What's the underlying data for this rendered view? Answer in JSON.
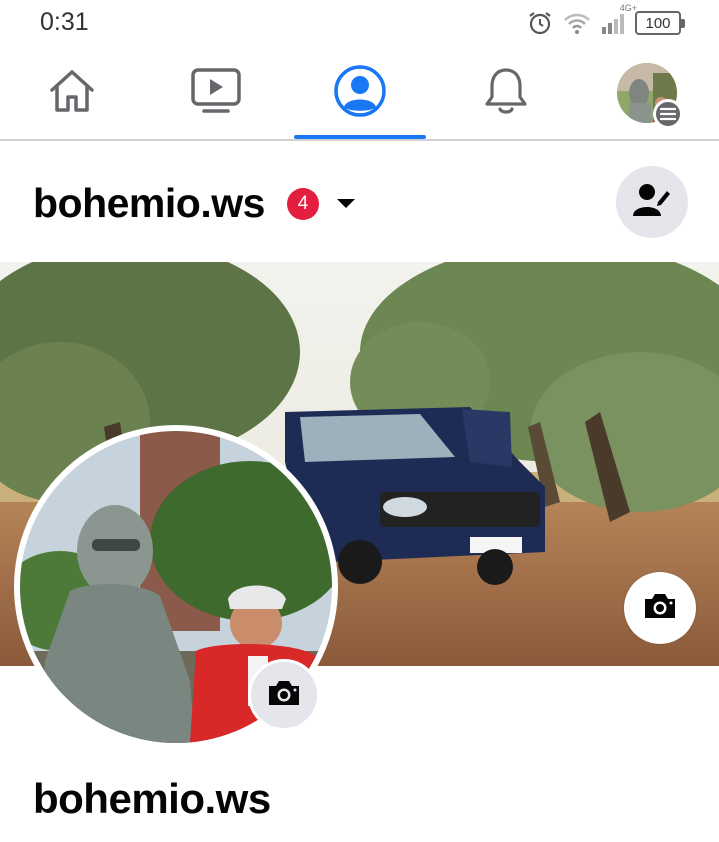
{
  "status_bar": {
    "time": "0:31",
    "network_label": "4G+",
    "battery": "100",
    "icons": [
      "alarm-icon",
      "wifi-icon",
      "signal-icon",
      "battery-icon"
    ]
  },
  "nav": {
    "items": [
      {
        "name": "home",
        "icon": "home-icon",
        "active": false
      },
      {
        "name": "watch",
        "icon": "video-icon",
        "active": false
      },
      {
        "name": "profile",
        "icon": "profile-icon",
        "active": true
      },
      {
        "name": "notifications",
        "icon": "bell-icon",
        "active": false
      },
      {
        "name": "menu",
        "icon": "avatar-menu-icon",
        "active": false
      }
    ],
    "accent_color": "#1877f2"
  },
  "header": {
    "username": "bohemio.ws",
    "notification_count": "4",
    "badge_color": "#e41e3f"
  },
  "profile": {
    "display_name": "bohemio.ws"
  }
}
